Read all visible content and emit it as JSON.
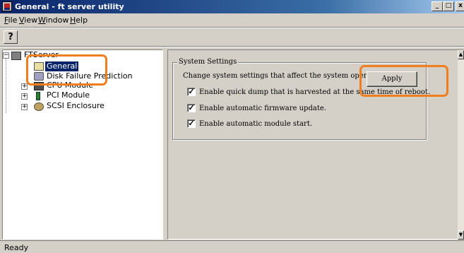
{
  "window": {
    "title": "General - ft server utility",
    "buttons": {
      "minimize": "_",
      "maximize": "□",
      "close": "x"
    }
  },
  "menu": {
    "file": "File",
    "view": "View",
    "window": "Window",
    "help": "Help"
  },
  "toolbar": {
    "help_glyph": "?"
  },
  "tree": {
    "root": "FTServer",
    "items": [
      {
        "label": "General",
        "selected": true
      },
      {
        "label": "Disk Failure Prediction"
      },
      {
        "label": "CPU Module"
      },
      {
        "label": "PCI Module"
      },
      {
        "label": "SCSI Enclosure"
      }
    ]
  },
  "settings": {
    "group_title": "System Settings",
    "description": "Change system settings that affect the system operation.",
    "apply_label": "Apply",
    "options": [
      {
        "label": "Enable quick dump that is harvested at the same time of reboot.",
        "checked": true
      },
      {
        "label": "Enable automatic firmware update.",
        "checked": true
      },
      {
        "label": "Enable automatic module start.",
        "checked": true
      }
    ],
    "check_glyph": "✓"
  },
  "status": {
    "text": "Ready"
  },
  "colors": {
    "titlebar": "#0a246a",
    "highlight": "#f07d1e",
    "selection": "#0a246a"
  }
}
